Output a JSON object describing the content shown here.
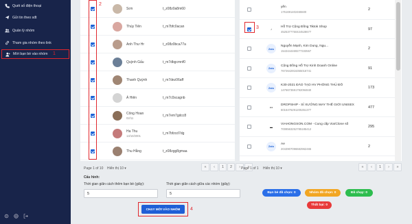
{
  "sidebar": {
    "items": [
      {
        "label": "Quét số điện thoại",
        "icon": "phone-icon"
      },
      {
        "label": "Gửi tin theo sđt",
        "icon": "send-icon"
      },
      {
        "label": "Quản lý nhóm",
        "icon": "group-icon"
      },
      {
        "label": "Tham gia nhóm theo link",
        "icon": "link-icon"
      },
      {
        "label": "Mời bạn bè vào nhóm",
        "icon": "user-add-icon"
      }
    ],
    "annotation": "1"
  },
  "friends": {
    "annotation": "2",
    "rows": [
      {
        "name": "Sơn",
        "sub": "",
        "id": "t_z08z0a8m60",
        "checked": true,
        "avatar_color": "#c9b8a8"
      },
      {
        "name": "Thùy Tiên",
        "sub": "",
        "id": "t_m7bfc0acan",
        "checked": true,
        "avatar_color": "#d9a7a0"
      },
      {
        "name": "Anh Thư Hr",
        "sub": "",
        "id": "t_z08z0bca77a",
        "checked": true,
        "avatar_color": "#b99c8c"
      },
      {
        "name": "Quỳnh Gấu",
        "sub": "",
        "id": "t_m7dbgcmnf0",
        "checked": true,
        "avatar_color": "#6b7f97"
      },
      {
        "name": "Thanh Quỳnh",
        "sub": "",
        "id": "t_m7dez06aff",
        "checked": true,
        "avatar_color": "#a08674"
      },
      {
        "name": "Á Hiên",
        "sub": "",
        "id": "t_m7c0scagnb",
        "checked": true,
        "avatar_color": "#d4d4d4"
      },
      {
        "name": "Công Hoan",
        "sub": "02/11",
        "id": "t_m7em7gdcc8",
        "checked": true,
        "avatar_color": "#8a6e58"
      },
      {
        "name": "Ha Thu",
        "sub": "13/10/2001",
        "id": "t_m7bfzcd7dg",
        "checked": true,
        "avatar_color": "#c47a7a"
      },
      {
        "name": "Thu Hằng",
        "sub": "",
        "id": "t_z08zgg8gmaa",
        "checked": true,
        "avatar_color": "#9a8070"
      }
    ],
    "pagination": {
      "page_text": "Page 1 of 10",
      "show_text": "Hiển thị 10",
      "buttons": [
        "«",
        "‹",
        "1",
        "2",
        "›",
        "»"
      ]
    }
  },
  "groups": {
    "annotation": "3",
    "rows": [
      {
        "name": "yến",
        "id": "1751691402465500",
        "count": "2",
        "checked": false,
        "logo": "",
        "logo_bg": "#ffffff"
      },
      {
        "name": "Hỗ Trợ Cộng Đồng Tiktok Shop",
        "id": "4525377750424528677",
        "count": "97",
        "checked": true,
        "logo": "♪",
        "logo_bg": "#ffffff"
      },
      {
        "name": "Nguyễn Mạnh, Kim Dung, Ngu...",
        "id": "1543444469277333557",
        "count": "2",
        "checked": false,
        "logo": "Zalo",
        "logo_bg": "#e8f0fe"
      },
      {
        "name": "Cộng Đồng Hỗ Trợ Kinh Doanh Online",
        "id": "7672642916355016741",
        "count": "91",
        "checked": false,
        "logo": "Zalo",
        "logo_bg": "#e8f0fe"
      },
      {
        "name": "K30-2021 ĐÀO TẠO HV PHÒNG THỦ ĐÔ",
        "id": "1476673591792094840",
        "count": "173",
        "checked": false,
        "logo": "Zalo",
        "logo_bg": "#e8f0fe"
      },
      {
        "name": "DROPSHIP - SỈ XƯỞNG MAY THẾ GIỚI UNISEX",
        "id": "6016476291205351377",
        "count": "477",
        "checked": false,
        "logo": "•••",
        "logo_bg": "#ffffff"
      },
      {
        "name": "VIAHONGSON.COM - Cung cấp Via/Clone số",
        "id": "7008563252785185412",
        "count": "295",
        "checked": false,
        "logo": "▬",
        "logo_bg": "#ffffff"
      },
      {
        "name": "Ae",
        "id": "2043907096682962465",
        "count": "2",
        "checked": false,
        "logo": "Zalo",
        "logo_bg": "#e8f0fe"
      }
    ],
    "pagination": {
      "page_text": "Page 1 of 1",
      "show_text": "Hiển thị 10",
      "buttons": [
        "«",
        "‹",
        "1",
        "›",
        "»"
      ]
    }
  },
  "config": {
    "title": "Cấu hình:",
    "friend_interval_label": "Thời gian giãn cách thêm bạn bè (giây):",
    "friend_interval_value": "5",
    "group_interval_label": "Thời gian giãn cách giữa các nhóm (giây):",
    "group_interval_value": "5",
    "run_button": "CHẠY MỜI VÀO NHÓM",
    "run_annotation": "4"
  },
  "status": {
    "friends_selected": "Bạn bè đã chọn: 0",
    "groups_selected": "Nhóm đã chọn: 0",
    "done": "Đã chạy: 0",
    "failed": "Thất bại: 0",
    "colors": {
      "blue": "#2b6fe8",
      "orange": "#f2a623",
      "green": "#2ebd4f",
      "red": "#e83a3a"
    }
  }
}
